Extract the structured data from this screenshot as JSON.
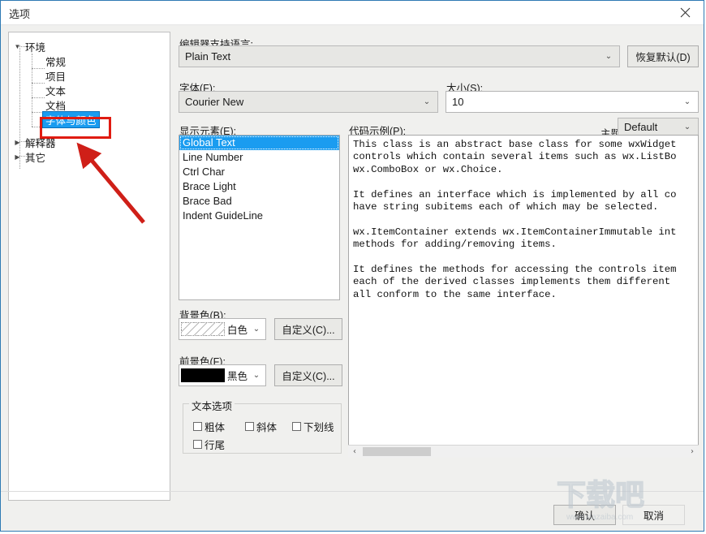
{
  "window": {
    "title": "选项",
    "close_icon": "close-icon"
  },
  "tree": {
    "items": [
      {
        "label": "环境",
        "level": 0,
        "expander": "▼",
        "selected": false
      },
      {
        "label": "常规",
        "level": 1,
        "expander": "",
        "selected": false
      },
      {
        "label": "项目",
        "level": 1,
        "expander": "",
        "selected": false
      },
      {
        "label": "文本",
        "level": 1,
        "expander": "",
        "selected": false
      },
      {
        "label": "文档",
        "level": 1,
        "expander": "",
        "selected": false
      },
      {
        "label": "字体与颜色",
        "level": 1,
        "expander": "",
        "selected": true
      },
      {
        "label": "解释器",
        "level": 0,
        "expander": "▶",
        "selected": false
      },
      {
        "label": "其它",
        "level": 0,
        "expander": "▶",
        "selected": false
      }
    ]
  },
  "form": {
    "language_label": "编辑器支持语言:",
    "language_value": "Plain Text",
    "restore_defaults_label": "恢复默认(D)",
    "font_label": "字体(F):",
    "font_value": "Courier New",
    "size_label": "大小(S):",
    "size_value": "10",
    "theme_label": "主题:",
    "theme_value": "Default",
    "display_elements_label": "显示元素(E):",
    "display_elements": [
      "Global Text",
      "Line Number",
      "Ctrl Char",
      "Brace Light",
      "Brace Bad",
      "Indent GuideLine"
    ],
    "display_elements_selected": "Global Text",
    "code_sample_label": "代码示例(P):",
    "code_sample": "This class is an abstract base class for some wxWidget\ncontrols which contain several items such as wx.ListBo\nwx.ComboBox or wx.Choice.\n\nIt defines an interface which is implemented by all co\nhave string subitems each of which may be selected.\n\nwx.ItemContainer extends wx.ItemContainerImmutable int\nmethods for adding/removing items.\n\nIt defines the methods for accessing the controls item\neach of the derived classes implements them different\nall conform to the same interface.",
    "background_label": "背景色(B):",
    "background_value": "白色",
    "background_color": "#ffffff",
    "background_custom_label": "自定义(C)...",
    "foreground_label": "前景色(F):",
    "foreground_value": "黑色",
    "foreground_color": "#000000",
    "foreground_custom_label": "自定义(C)...",
    "text_options_title": "文本选项",
    "text_options": [
      {
        "label": "粗体",
        "checked": false
      },
      {
        "label": "斜体",
        "checked": false
      },
      {
        "label": "下划线",
        "checked": false
      },
      {
        "label": "行尾",
        "checked": false
      }
    ]
  },
  "scrollbar": {
    "left_arrow": "‹",
    "right_arrow": "›"
  },
  "footer": {
    "ok_label": "确认",
    "cancel_label": "取消"
  },
  "annotation": {
    "highlight_color": "#e01b11",
    "arrow_name": "red-arrow-pointer"
  },
  "watermark": {
    "brand": "下载吧",
    "url": "www.xiazaiba.com"
  }
}
